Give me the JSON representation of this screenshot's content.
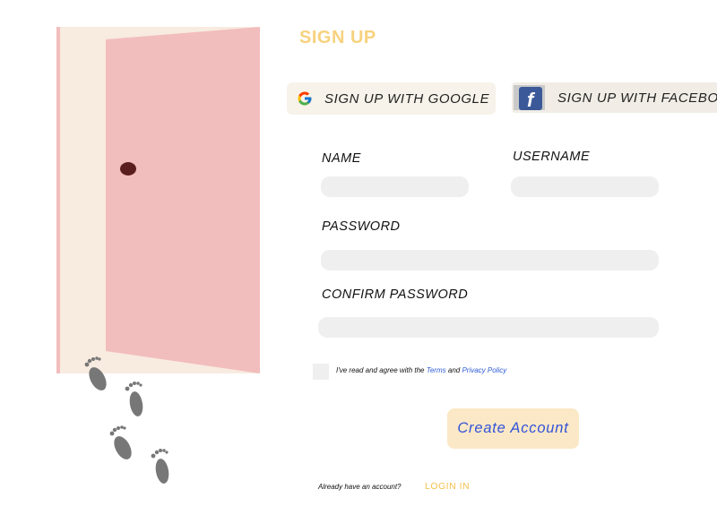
{
  "page": {
    "title": "SIGN UP"
  },
  "social": {
    "google_label": "SIGN UP WITH GOOGLE",
    "facebook_label": "SIGN UP WITH FACEBOOK"
  },
  "form": {
    "name_label": "NAME",
    "name_value": "",
    "username_label": "USERNAME",
    "username_value": "",
    "password_label": "PASSWORD",
    "password_value": "",
    "confirm_label": "CONFIRM PASSWORD",
    "confirm_value": ""
  },
  "agreement": {
    "prefix": "I've read and agree with the ",
    "terms": "Terms",
    "and": " and ",
    "privacy": "Privacy Policy",
    "checked": false
  },
  "submit_label": "Create Account",
  "footer": {
    "prompt": "Already have an account?",
    "login_label": "LOGIN IN"
  },
  "colors": {
    "accent": "#f7d27e",
    "link": "#2f5bd6",
    "door": "#f2bdbd",
    "frame": "#f8ebe0",
    "knob": "#5a1e1e",
    "footprint": "#777777"
  },
  "illustration": {
    "icons": [
      "door-icon",
      "door-knob-icon",
      "footprint-icon"
    ]
  }
}
